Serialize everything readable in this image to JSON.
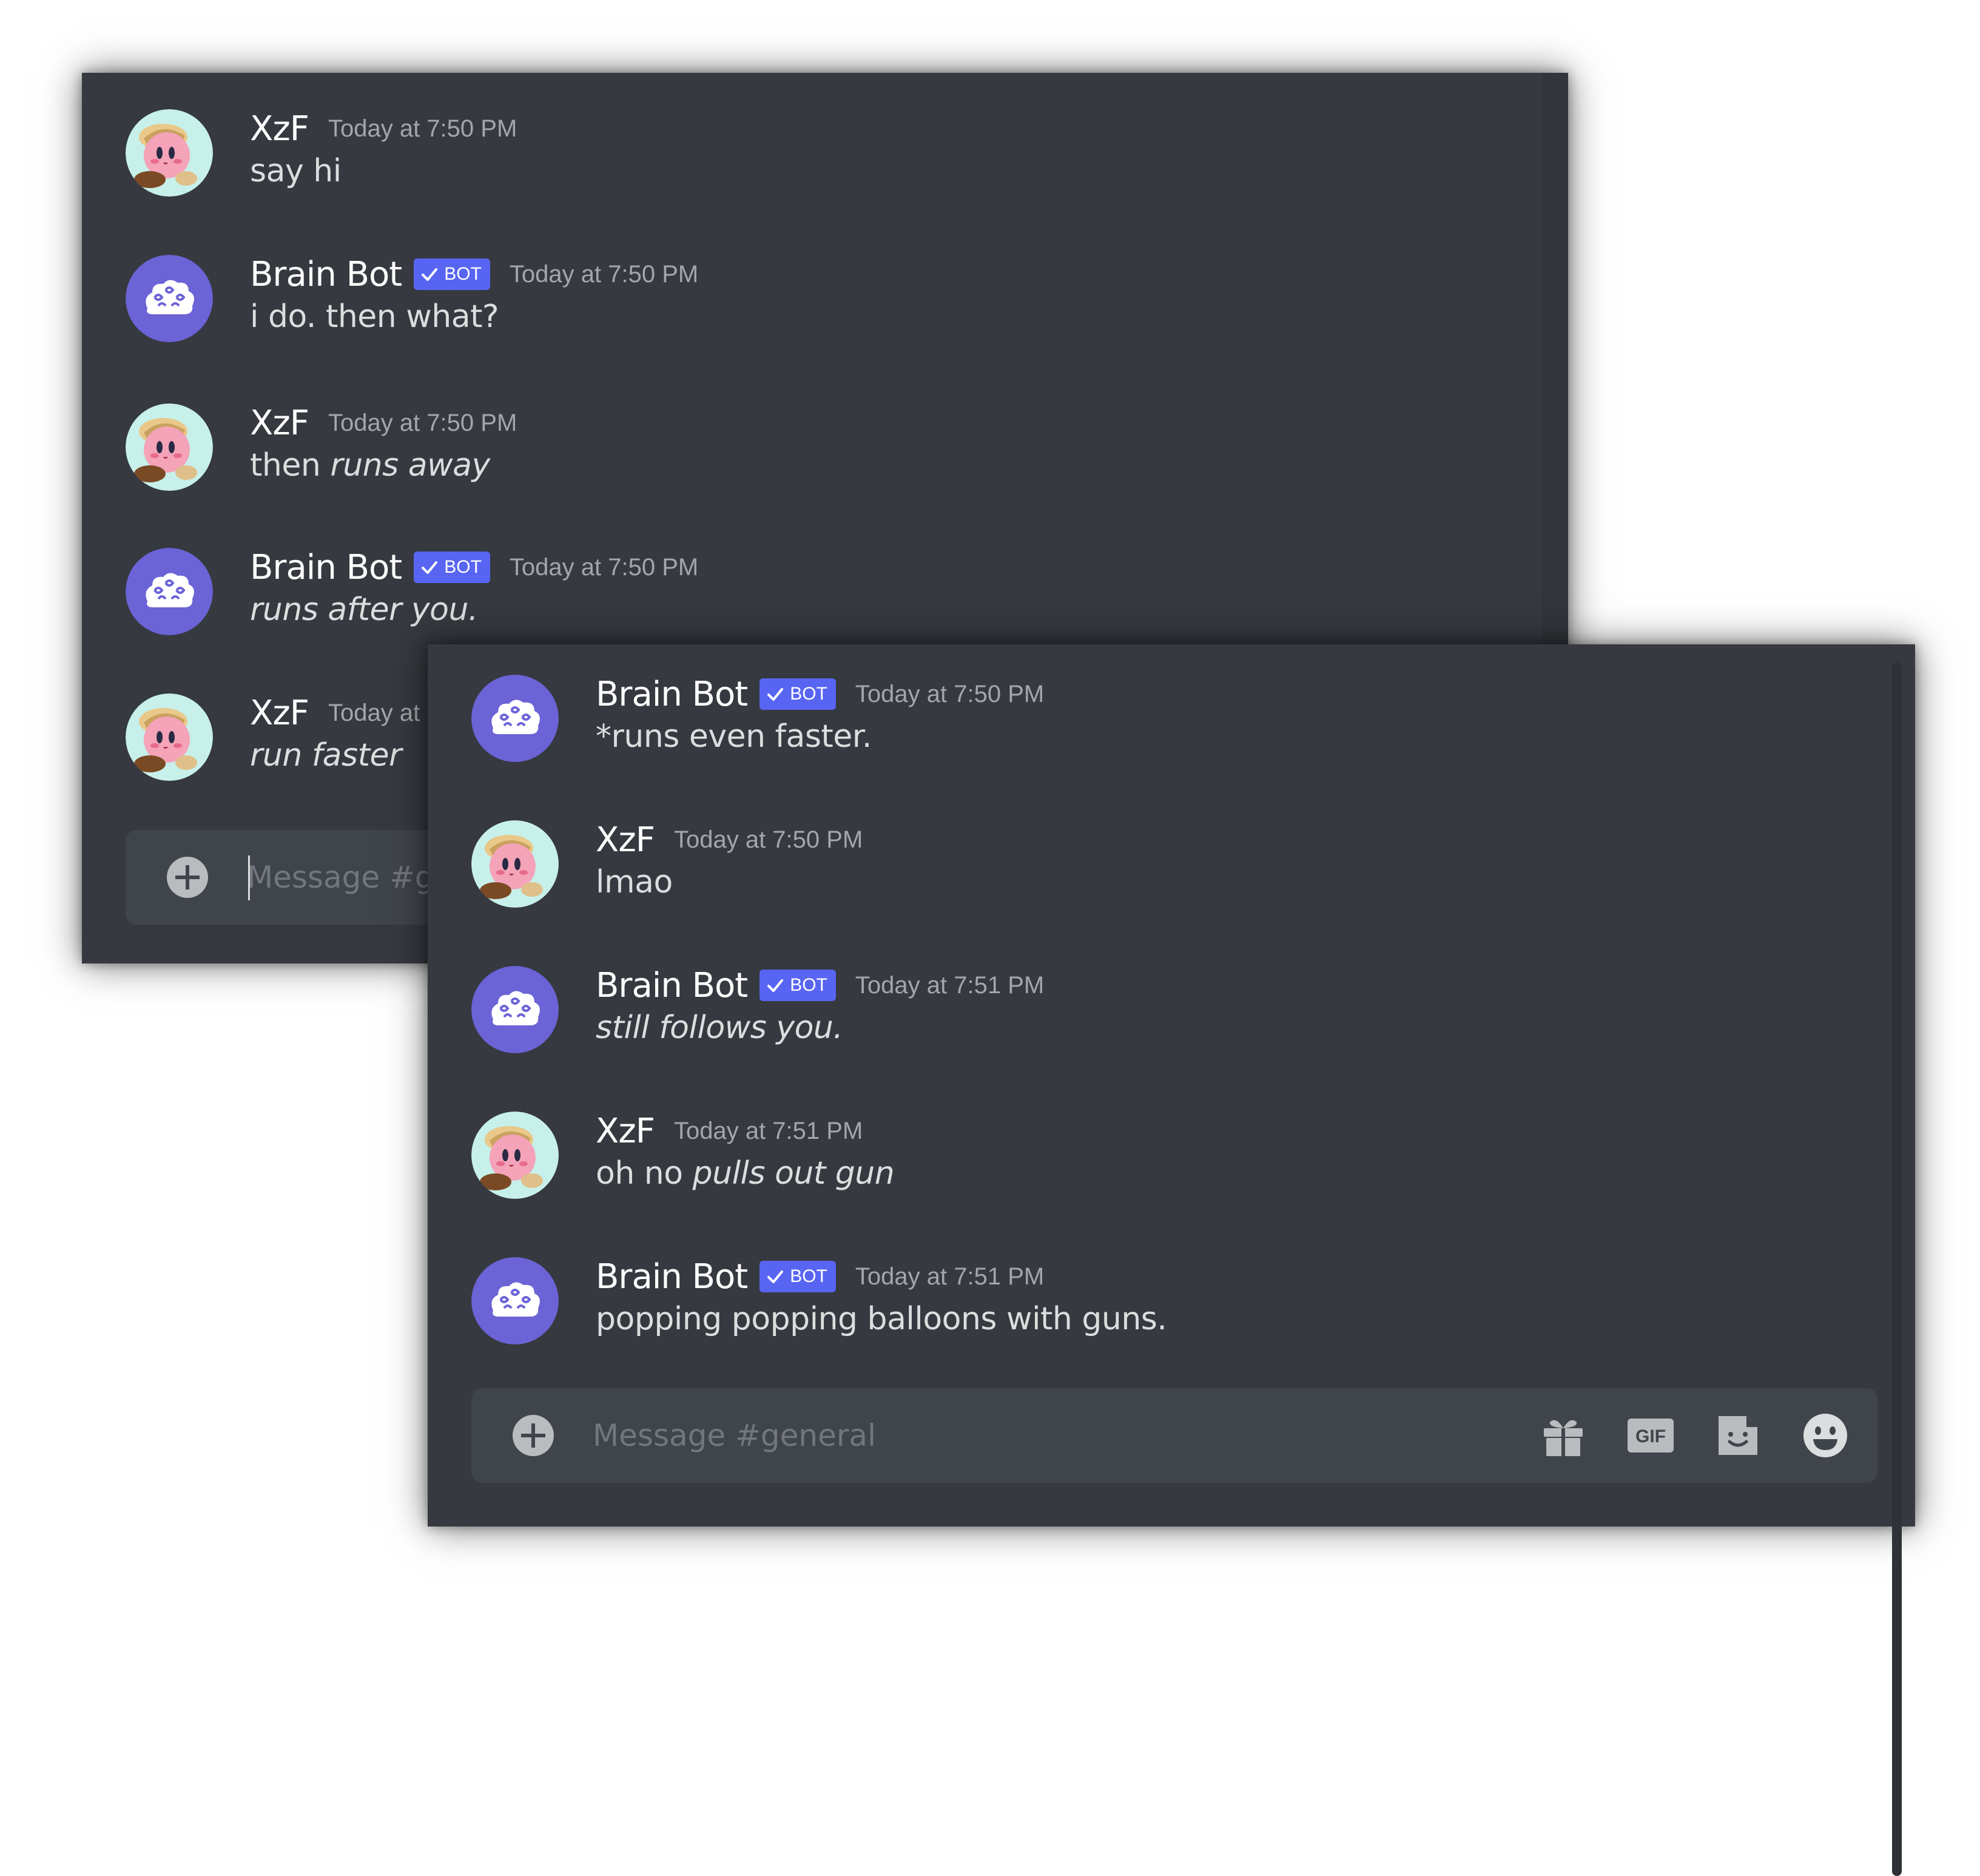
{
  "channel_placeholder": "Message #general",
  "colors": {
    "background": "#36393f",
    "composer": "#40444b",
    "bot_tag": "#5865f2",
    "author": "#ffffff",
    "text": "#dcddde",
    "timestamp": "#a3a6aa",
    "placeholder": "#72767d"
  },
  "back_panel": {
    "messages": [
      {
        "author": "XzF",
        "timestamp": "Today at 7:50 PM",
        "text": "say hi",
        "avatar": "kirby-avatar"
      },
      {
        "author": "Brain Bot",
        "bot_tag": "BOT",
        "timestamp": "Today at 7:50 PM",
        "text": "i do. then what?",
        "avatar": "brain-avatar"
      },
      {
        "author": "XzF",
        "timestamp": "Today at 7:50 PM",
        "text_plain": "then ",
        "text_italic": "runs away",
        "avatar": "kirby-avatar"
      },
      {
        "author": "Brain Bot",
        "bot_tag": "BOT",
        "timestamp": "Today at 7:50 PM",
        "text_italic": "runs after you.",
        "avatar": "brain-avatar"
      },
      {
        "author": "XzF",
        "timestamp": "Today at",
        "text_italic": "run faster",
        "avatar": "kirby-avatar"
      }
    ],
    "input_placeholder": "Message #g"
  },
  "front_panel": {
    "messages": [
      {
        "author": "Brain Bot",
        "bot_tag": "BOT",
        "timestamp": "Today at 7:50 PM",
        "text": "*runs even faster.",
        "avatar": "brain-avatar"
      },
      {
        "author": "XzF",
        "timestamp": "Today at 7:50 PM",
        "text": "lmao",
        "avatar": "kirby-avatar"
      },
      {
        "author": "Brain Bot",
        "bot_tag": "BOT",
        "timestamp": "Today at 7:51 PM",
        "text_italic": "still follows you.",
        "avatar": "brain-avatar"
      },
      {
        "author": "XzF",
        "timestamp": "Today at 7:51 PM",
        "text_plain": "oh no ",
        "text_italic": "pulls out gun",
        "avatar": "kirby-avatar"
      },
      {
        "author": "Brain Bot",
        "bot_tag": "BOT",
        "timestamp": "Today at 7:51 PM",
        "text": "popping popping balloons with guns.",
        "avatar": "brain-avatar"
      }
    ],
    "input_placeholder": "Message #general",
    "composer_icons": [
      "gift-icon",
      "gif-icon",
      "sticker-icon",
      "emoji-icon"
    ],
    "gif_label": "GIF"
  }
}
